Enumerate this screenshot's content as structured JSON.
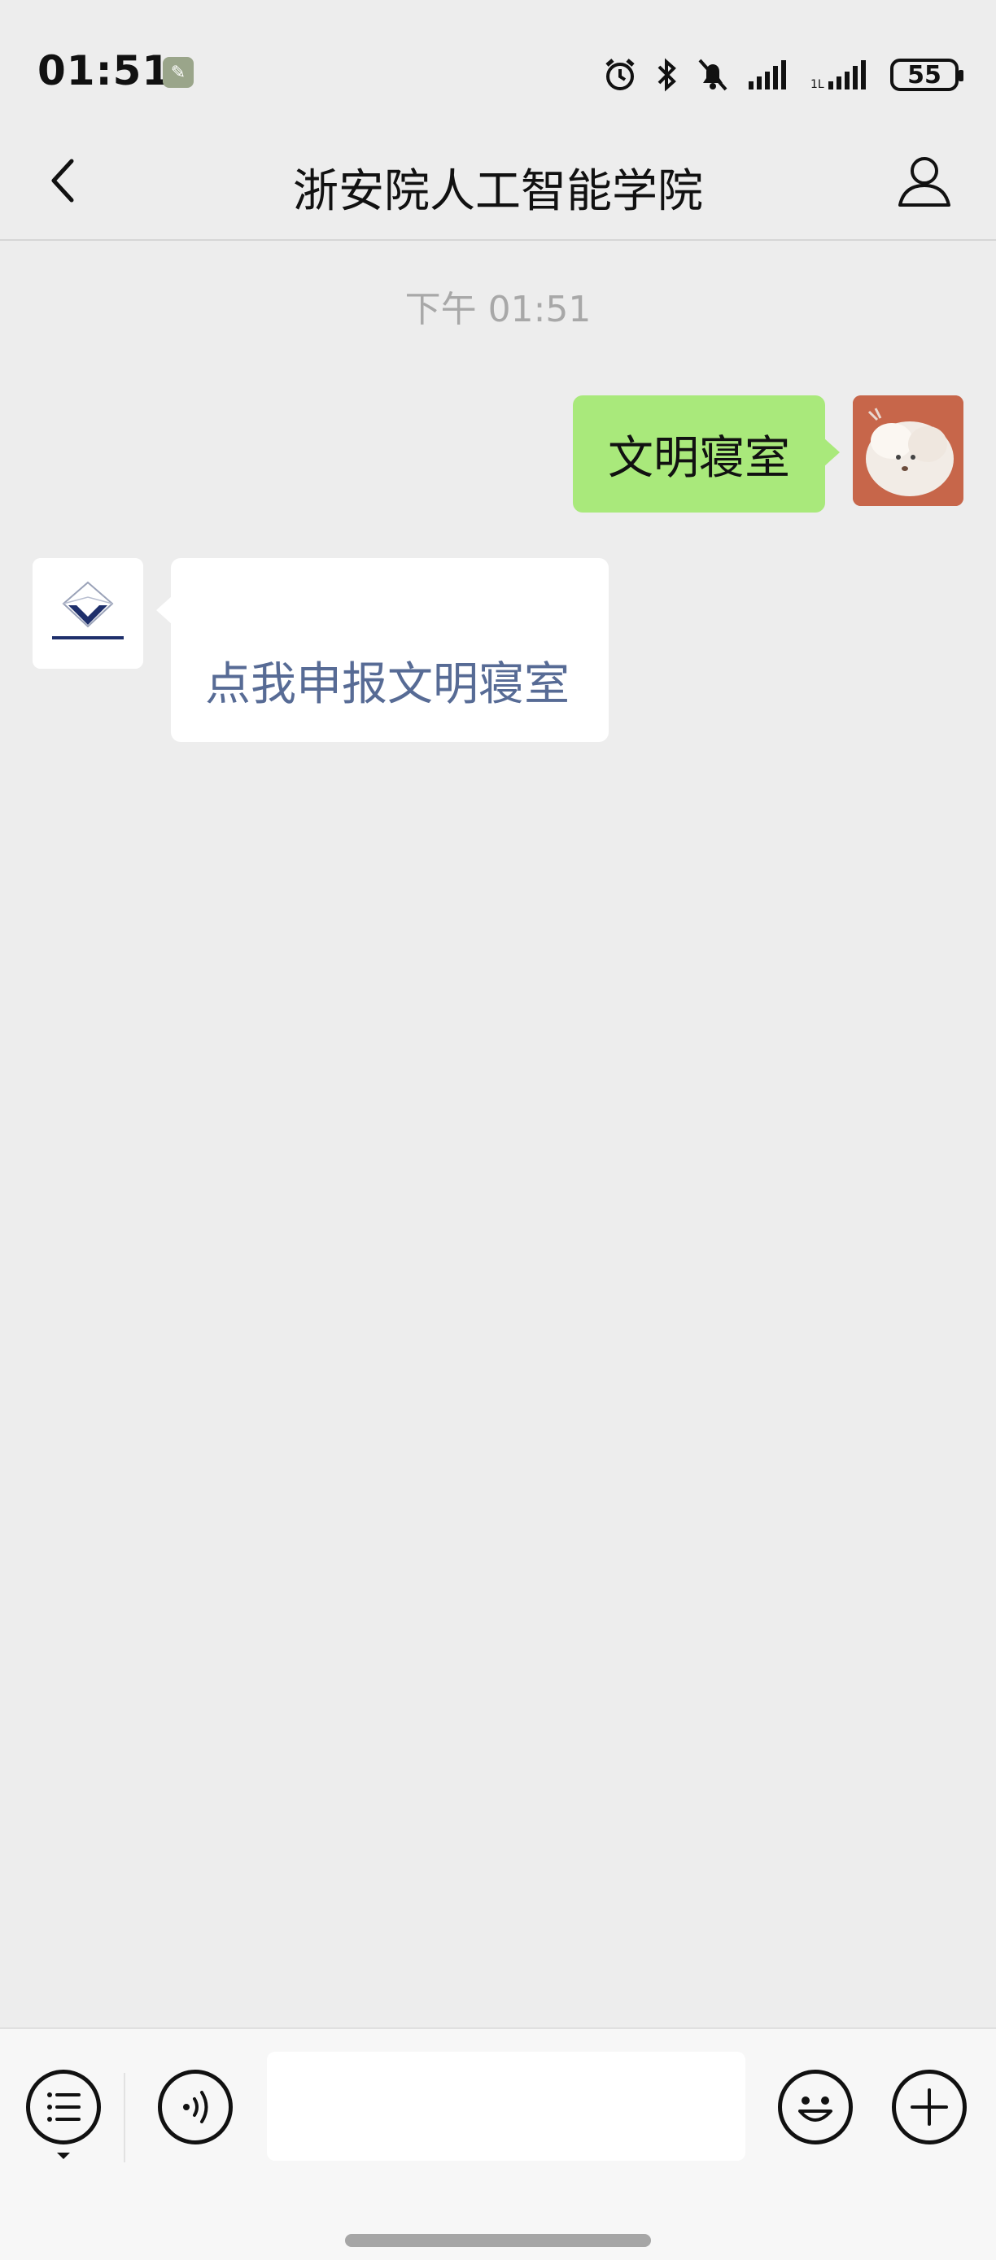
{
  "status_bar": {
    "time": "01:51",
    "battery": "55",
    "icons": [
      "app-notification-icon",
      "alarm-icon",
      "bluetooth-icon",
      "mute-bell-icon",
      "signal-icon",
      "signal-icon-2",
      "battery-icon"
    ]
  },
  "header": {
    "title": "浙安院人工智能学院",
    "back_icon": "back-chevron-icon",
    "profile_icon": "contact-profile-icon"
  },
  "chat": {
    "timestamp": "下午 01:51",
    "messages": [
      {
        "side": "right",
        "text": "文明寝室",
        "bubble_color": "#a9e97b"
      },
      {
        "side": "left",
        "text": "点我申报文明寝室",
        "link_color": "#576b95"
      }
    ]
  },
  "input_bar": {
    "menu_icon": "service-menu-icon",
    "voice_icon": "voice-input-icon",
    "placeholder": "",
    "emoji_icon": "emoji-icon",
    "plus_icon": "plus-icon"
  },
  "colors": {
    "background": "#ededed",
    "sent_bubble": "#a9e97b",
    "link": "#576b95"
  }
}
